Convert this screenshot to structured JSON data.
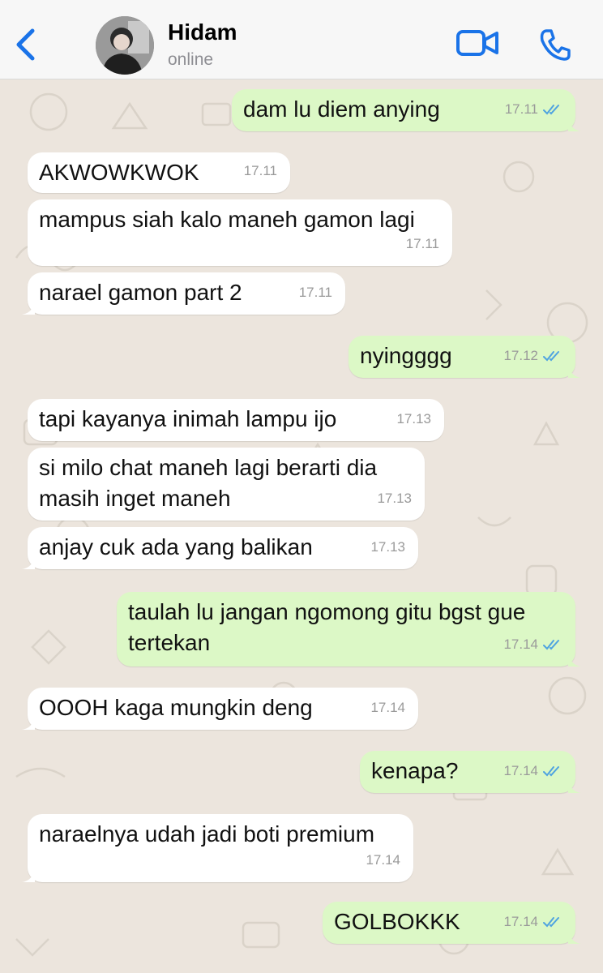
{
  "header": {
    "contact_name": "Hidam",
    "status": "online",
    "accent_color": "#1A73E8"
  },
  "icons": [
    "chevron-left-icon",
    "video-camera-icon",
    "phone-icon",
    "double-check-icon"
  ],
  "messages": [
    {
      "dir": "out",
      "text": "dam lu diem anying",
      "time": "17.11",
      "read": true
    },
    {
      "dir": "in",
      "text": "AKWOWKWOK",
      "time": "17.11"
    },
    {
      "dir": "in",
      "text": "mampus siah kalo maneh gamon lagi",
      "time": "17.11"
    },
    {
      "dir": "in",
      "text": "narael gamon part 2",
      "time": "17.11"
    },
    {
      "dir": "out",
      "text": "nyingggg",
      "time": "17.12",
      "read": true
    },
    {
      "dir": "in",
      "text": "tapi kayanya inimah lampu ijo",
      "time": "17.13"
    },
    {
      "dir": "in",
      "text_lines": [
        "si milo chat maneh lagi berarti dia",
        "masih inget maneh"
      ],
      "time": "17.13"
    },
    {
      "dir": "in",
      "text": "anjay cuk ada yang balikan",
      "time": "17.13"
    },
    {
      "dir": "out",
      "text_lines": [
        "taulah lu jangan ngomong gitu bgst gue",
        "tertekan"
      ],
      "time": "17.14",
      "read": true
    },
    {
      "dir": "in",
      "text": "OOOH kaga mungkin deng",
      "time": "17.14"
    },
    {
      "dir": "out",
      "text": "kenapa?",
      "time": "17.14",
      "read": true
    },
    {
      "dir": "in",
      "text": "naraelnya udah jadi boti premium",
      "time": "17.14"
    },
    {
      "dir": "out",
      "text": "GOLBOKKK",
      "time": "17.14",
      "read": true
    }
  ]
}
